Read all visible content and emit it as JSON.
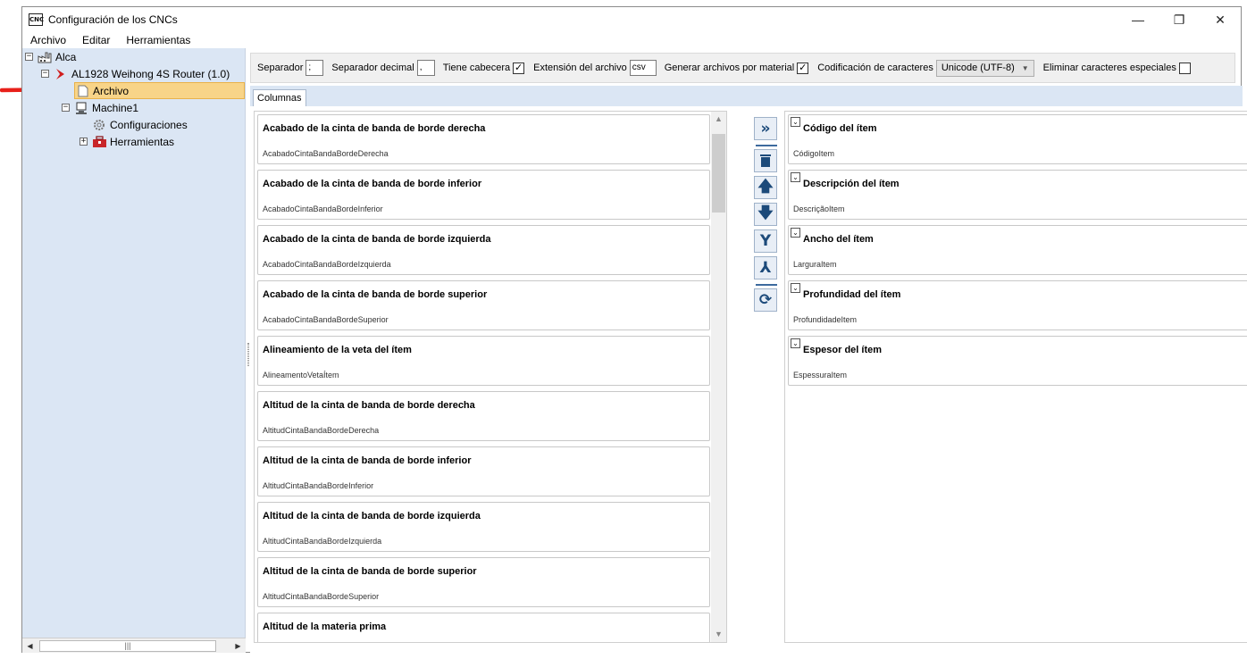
{
  "window": {
    "app_icon_text": "CNC",
    "title": "Configuración de los CNCs",
    "controls": {
      "minimize": "—",
      "restore": "❐",
      "close": "✕"
    }
  },
  "menu": [
    "Archivo",
    "Editar",
    "Herramientas"
  ],
  "tree": {
    "root": "Alca",
    "machine": "AL1928 Weihong 4S Router (1.0)",
    "archivo": "Archivo",
    "machine1": "Machine1",
    "configuraciones": "Configuraciones",
    "herramientas": "Herramientas"
  },
  "options": {
    "separador_label": "Separador",
    "separador_value": ";",
    "decimal_label": "Separador decimal",
    "decimal_value": ",",
    "cabecera_label": "Tiene cabecera",
    "cabecera_checked": true,
    "extension_label": "Extensión del archivo",
    "extension_value": "csv",
    "por_material_label": "Generar archivos por material",
    "por_material_checked": true,
    "codificacion_label": "Codificación de caracteres",
    "codificacion_value": "Unicode (UTF-8)",
    "eliminar_label": "Eliminar caracteres especiales",
    "eliminar_checked": false
  },
  "tabs": [
    "Columnas"
  ],
  "available_columns": [
    {
      "title": "Acabado de la cinta de banda de borde derecha",
      "key": "AcabadoCintaBandaBordeDerecha"
    },
    {
      "title": "Acabado de la cinta de banda de borde inferior",
      "key": "AcabadoCintaBandaBordeInferior"
    },
    {
      "title": "Acabado de la cinta de banda de borde izquierda",
      "key": "AcabadoCintaBandaBordeIzquierda"
    },
    {
      "title": "Acabado de la cinta de banda de borde superior",
      "key": "AcabadoCintaBandaBordeSuperior"
    },
    {
      "title": "Alineamiento de la veta del ítem",
      "key": "AlineamentoVetaÍtem"
    },
    {
      "title": "Altitud de la cinta de banda de borde derecha",
      "key": "AltitudCintaBandaBordeDerecha"
    },
    {
      "title": "Altitud de la cinta de banda de borde inferior",
      "key": "AltitudCintaBandaBordeInferior"
    },
    {
      "title": "Altitud de la cinta de banda de borde izquierda",
      "key": "AltitudCintaBandaBordeIzquierda"
    },
    {
      "title": "Altitud de la cinta de banda de borde superior",
      "key": "AltitudCintaBandaBordeSuperior"
    },
    {
      "title": "Altitud de la materia prima",
      "key": ""
    }
  ],
  "selected_columns": [
    {
      "title": "Código del ítem",
      "key": "CódigoItem"
    },
    {
      "title": "Descripción del ítem",
      "key": "DescriçãoItem"
    },
    {
      "title": "Ancho del ítem",
      "key": "LarguraItem"
    },
    {
      "title": "Profundidad del ítem",
      "key": "ProfundidadeItem"
    },
    {
      "title": "Espesor del ítem",
      "key": "EspessuraItem"
    }
  ],
  "toolbar_icons": [
    "add-columns-icon",
    "delete-icon",
    "move-up-icon",
    "move-down-icon",
    "merge-icon",
    "split-icon",
    "refresh-icon"
  ],
  "colors": {
    "tree_bg": "#dbe6f4",
    "selected_bg": "#f8d488",
    "annotation_arrow": "#e8201a"
  }
}
